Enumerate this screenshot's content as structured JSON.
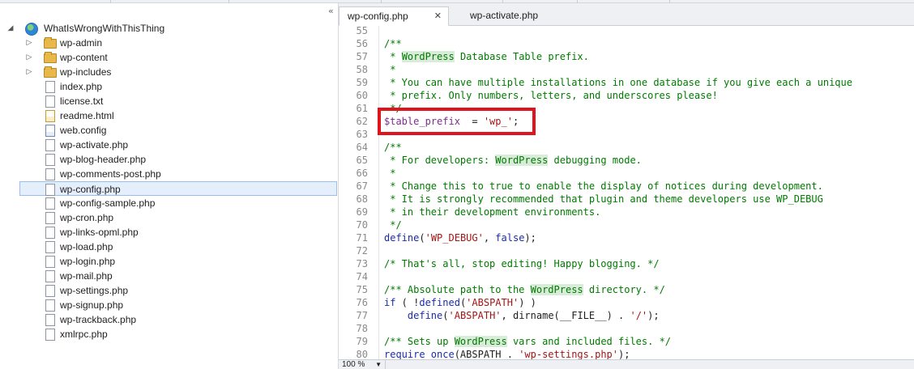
{
  "tree": {
    "root": "WhatIsWrongWithThisThing",
    "collapse_glyph": "«",
    "items": [
      {
        "label": "wp-admin",
        "type": "folder"
      },
      {
        "label": "wp-content",
        "type": "folder"
      },
      {
        "label": "wp-includes",
        "type": "folder"
      },
      {
        "label": "index.php",
        "type": "file"
      },
      {
        "label": "license.txt",
        "type": "file"
      },
      {
        "label": "readme.html",
        "type": "html"
      },
      {
        "label": "web.config",
        "type": "config"
      },
      {
        "label": "wp-activate.php",
        "type": "file"
      },
      {
        "label": "wp-blog-header.php",
        "type": "file"
      },
      {
        "label": "wp-comments-post.php",
        "type": "file"
      },
      {
        "label": "wp-config.php",
        "type": "file",
        "selected": true
      },
      {
        "label": "wp-config-sample.php",
        "type": "file"
      },
      {
        "label": "wp-cron.php",
        "type": "file"
      },
      {
        "label": "wp-links-opml.php",
        "type": "file"
      },
      {
        "label": "wp-load.php",
        "type": "file"
      },
      {
        "label": "wp-login.php",
        "type": "file"
      },
      {
        "label": "wp-mail.php",
        "type": "file"
      },
      {
        "label": "wp-settings.php",
        "type": "file"
      },
      {
        "label": "wp-signup.php",
        "type": "file"
      },
      {
        "label": "wp-trackback.php",
        "type": "file"
      },
      {
        "label": "xmlrpc.php",
        "type": "file"
      }
    ]
  },
  "editor": {
    "tabs": [
      {
        "label": "wp-config.php",
        "active": true,
        "close_glyph": "✕"
      },
      {
        "label": "wp-activate.php",
        "active": false
      }
    ],
    "zoom": "100 %",
    "lines": [
      {
        "n": "55",
        "segs": []
      },
      {
        "n": "56",
        "segs": [
          {
            "t": "/**",
            "c": "c"
          }
        ]
      },
      {
        "n": "57",
        "segs": [
          {
            "t": " * ",
            "c": "c"
          },
          {
            "t": "WordPress",
            "c": "hl"
          },
          {
            "t": " Database Table prefix.",
            "c": "c"
          }
        ]
      },
      {
        "n": "58",
        "segs": [
          {
            "t": " *",
            "c": "c"
          }
        ]
      },
      {
        "n": "59",
        "segs": [
          {
            "t": " * You can have multiple installations in one database if you give each a unique",
            "c": "c"
          }
        ]
      },
      {
        "n": "60",
        "segs": [
          {
            "t": " * prefix. Only numbers, letters, and underscores please!",
            "c": "c"
          }
        ]
      },
      {
        "n": "61",
        "segs": [
          {
            "t": " */",
            "c": "c"
          }
        ]
      },
      {
        "n": "62",
        "segs": [
          {
            "t": "$table_prefix",
            "c": "v"
          },
          {
            "t": "  = ",
            "c": "p"
          },
          {
            "t": "'wp_'",
            "c": "s"
          },
          {
            "t": ";",
            "c": "p"
          }
        ]
      },
      {
        "n": "63",
        "segs": []
      },
      {
        "n": "64",
        "segs": [
          {
            "t": "/**",
            "c": "c"
          }
        ]
      },
      {
        "n": "65",
        "segs": [
          {
            "t": " * For developers: ",
            "c": "c"
          },
          {
            "t": "WordPress",
            "c": "hl"
          },
          {
            "t": " debugging mode.",
            "c": "c"
          }
        ]
      },
      {
        "n": "66",
        "segs": [
          {
            "t": " *",
            "c": "c"
          }
        ]
      },
      {
        "n": "67",
        "segs": [
          {
            "t": " * Change this to true to enable the display of notices during development.",
            "c": "c"
          }
        ]
      },
      {
        "n": "68",
        "segs": [
          {
            "t": " * It is strongly recommended that plugin and theme developers use WP_DEBUG",
            "c": "c"
          }
        ]
      },
      {
        "n": "69",
        "segs": [
          {
            "t": " * in their development environments.",
            "c": "c"
          }
        ]
      },
      {
        "n": "70",
        "segs": [
          {
            "t": " */",
            "c": "c"
          }
        ]
      },
      {
        "n": "71",
        "segs": [
          {
            "t": "define",
            "c": "k"
          },
          {
            "t": "(",
            "c": "p"
          },
          {
            "t": "'WP_DEBUG'",
            "c": "s"
          },
          {
            "t": ", ",
            "c": "p"
          },
          {
            "t": "false",
            "c": "k"
          },
          {
            "t": ");",
            "c": "p"
          }
        ]
      },
      {
        "n": "72",
        "segs": []
      },
      {
        "n": "73",
        "segs": [
          {
            "t": "/* That's all, stop editing! Happy blogging. */",
            "c": "c"
          }
        ]
      },
      {
        "n": "74",
        "segs": []
      },
      {
        "n": "75",
        "segs": [
          {
            "t": "/** Absolute path to the ",
            "c": "c"
          },
          {
            "t": "WordPress",
            "c": "hl"
          },
          {
            "t": " directory. */",
            "c": "c"
          }
        ]
      },
      {
        "n": "76",
        "segs": [
          {
            "t": "if",
            "c": "k"
          },
          {
            "t": " ( !",
            "c": "p"
          },
          {
            "t": "defined",
            "c": "k"
          },
          {
            "t": "(",
            "c": "p"
          },
          {
            "t": "'ABSPATH'",
            "c": "s"
          },
          {
            "t": ") )",
            "c": "p"
          }
        ]
      },
      {
        "n": "77",
        "segs": [
          {
            "t": "    ",
            "c": "p"
          },
          {
            "t": "define",
            "c": "k"
          },
          {
            "t": "(",
            "c": "p"
          },
          {
            "t": "'ABSPATH'",
            "c": "s"
          },
          {
            "t": ", dirname(__FILE__) . ",
            "c": "p"
          },
          {
            "t": "'/'",
            "c": "s"
          },
          {
            "t": ");",
            "c": "p"
          }
        ]
      },
      {
        "n": "78",
        "segs": []
      },
      {
        "n": "79",
        "segs": [
          {
            "t": "/** Sets up ",
            "c": "c"
          },
          {
            "t": "WordPress",
            "c": "hl"
          },
          {
            "t": " vars and included files. */",
            "c": "c"
          }
        ]
      },
      {
        "n": "80",
        "segs": [
          {
            "t": "require_once",
            "c": "k"
          },
          {
            "t": "(ABSPATH . ",
            "c": "p"
          },
          {
            "t": "'wp-settings.php'",
            "c": "s"
          },
          {
            "t": ");",
            "c": "p"
          }
        ]
      }
    ]
  },
  "colors": {
    "callout": "#e0141e",
    "selection": "#e5eefb"
  }
}
